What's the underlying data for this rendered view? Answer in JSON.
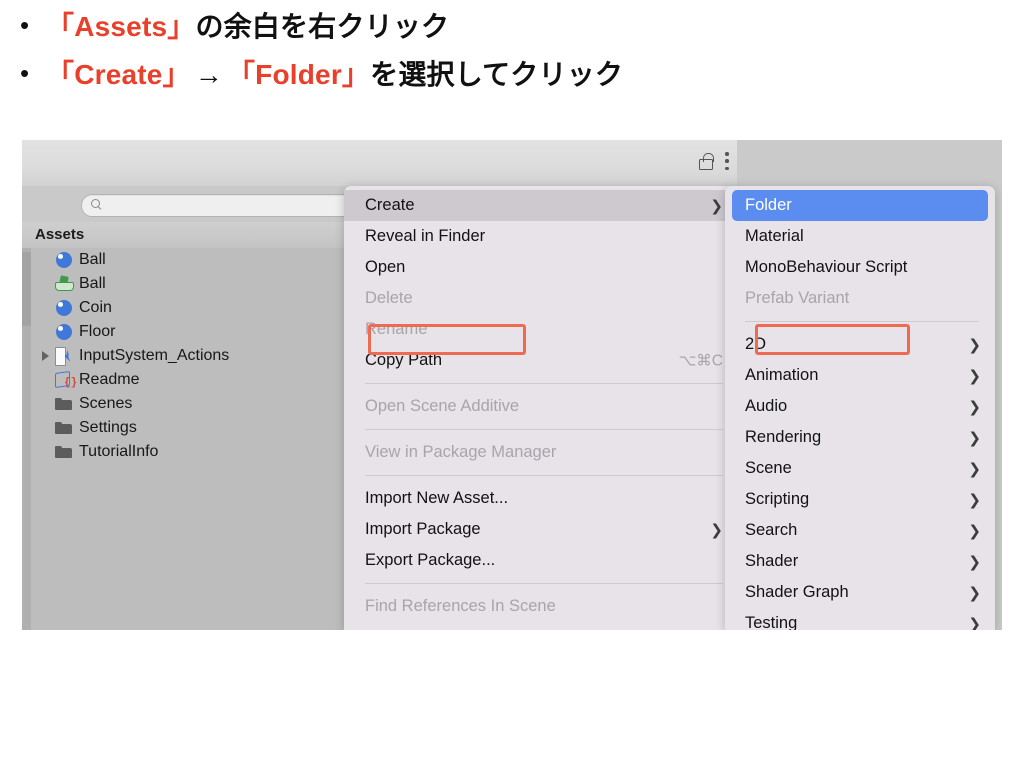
{
  "slide": {
    "bullets": [
      {
        "marker": "•",
        "segments": [
          {
            "text": "「Assets」",
            "style": "hl"
          },
          {
            "text": "の余白を右クリック",
            "style": "nm"
          }
        ]
      },
      {
        "marker": "•",
        "segments": [
          {
            "text": "「Create」",
            "style": "hl"
          },
          {
            "text": " → ",
            "style": "arrow"
          },
          {
            "text": "「Folder」",
            "style": "hl"
          },
          {
            "text": "を選択してクリック",
            "style": "nm"
          }
        ]
      }
    ],
    "bullet1_marker": "•",
    "bullet1_a": "「Assets」",
    "bullet1_b": "の余白を右クリック",
    "bullet2_marker": "•",
    "bullet2_a": "「Create」",
    "bullet2_arrow": "→",
    "bullet2_b": "「Folder」",
    "bullet2_c": "を選択してクリック",
    "accent_color": "#e8402a",
    "text_color": "#111111"
  },
  "unity": {
    "toolbar": {
      "lock_icon": "lock-open-icon",
      "menu_icon": "kebab-menu-icon"
    },
    "search": {
      "placeholder": "",
      "value": "",
      "icon": "search-icon"
    },
    "project_panel": {
      "header": "Assets",
      "items": [
        {
          "label": "Ball",
          "icon": "prefab-icon",
          "expandable": false,
          "indent": 1
        },
        {
          "label": "Ball",
          "icon": "physic-material-icon",
          "expandable": false,
          "indent": 1
        },
        {
          "label": "Coin",
          "icon": "prefab-icon",
          "expandable": false,
          "indent": 1
        },
        {
          "label": "Floor",
          "icon": "prefab-icon",
          "expandable": false,
          "indent": 1
        },
        {
          "label": "InputSystem_Actions",
          "icon": "input-actions-icon",
          "expandable": true,
          "indent": 1
        },
        {
          "label": "Readme",
          "icon": "script-asset-icon",
          "expandable": false,
          "indent": 1
        },
        {
          "label": "Scenes",
          "icon": "folder-icon",
          "expandable": false,
          "indent": 1
        },
        {
          "label": "Settings",
          "icon": "folder-icon",
          "expandable": false,
          "indent": 1
        },
        {
          "label": "TutorialInfo",
          "icon": "folder-icon",
          "expandable": false,
          "indent": 1
        }
      ]
    }
  },
  "context_menu": {
    "highlight_color": "#ef6a53",
    "items": [
      {
        "label": "Create",
        "disabled": false,
        "submenu": true,
        "highlighted": true,
        "shortcut": ""
      },
      {
        "label": "Reveal in Finder",
        "disabled": false,
        "submenu": false,
        "shortcut": ""
      },
      {
        "label": "Open",
        "disabled": false,
        "submenu": false,
        "shortcut": ""
      },
      {
        "label": "Delete",
        "disabled": true,
        "submenu": false,
        "shortcut": ""
      },
      {
        "label": "Rename",
        "disabled": true,
        "submenu": false,
        "shortcut": ""
      },
      {
        "label": "Copy Path",
        "disabled": false,
        "submenu": false,
        "shortcut": "⌥⌘C"
      },
      {
        "label": "Open Scene Additive",
        "disabled": true,
        "submenu": false,
        "shortcut": ""
      },
      {
        "label": "View in Package Manager",
        "disabled": true,
        "submenu": false,
        "shortcut": ""
      },
      {
        "label": "Import New Asset...",
        "disabled": false,
        "submenu": false,
        "shortcut": ""
      },
      {
        "label": "Import Package",
        "disabled": false,
        "submenu": true,
        "shortcut": ""
      },
      {
        "label": "Export Package...",
        "disabled": false,
        "submenu": false,
        "shortcut": ""
      },
      {
        "label": "Find References In Scene",
        "disabled": true,
        "submenu": false,
        "shortcut": ""
      }
    ]
  },
  "create_submenu": {
    "selected_bg": "#5b8cf0",
    "items": [
      {
        "label": "Folder",
        "disabled": false,
        "submenu": false,
        "selected": true
      },
      {
        "label": "Material",
        "disabled": false,
        "submenu": false,
        "selected": false
      },
      {
        "label": "MonoBehaviour Script",
        "disabled": false,
        "submenu": false,
        "selected": false
      },
      {
        "label": "Prefab Variant",
        "disabled": true,
        "submenu": false,
        "selected": false
      },
      {
        "label": "2D",
        "disabled": false,
        "submenu": true,
        "selected": false
      },
      {
        "label": "Animation",
        "disabled": false,
        "submenu": true,
        "selected": false
      },
      {
        "label": "Audio",
        "disabled": false,
        "submenu": true,
        "selected": false
      },
      {
        "label": "Rendering",
        "disabled": false,
        "submenu": true,
        "selected": false
      },
      {
        "label": "Scene",
        "disabled": false,
        "submenu": true,
        "selected": false
      },
      {
        "label": "Scripting",
        "disabled": false,
        "submenu": true,
        "selected": false
      },
      {
        "label": "Search",
        "disabled": false,
        "submenu": true,
        "selected": false
      },
      {
        "label": "Shader",
        "disabled": false,
        "submenu": true,
        "selected": false
      },
      {
        "label": "Shader Graph",
        "disabled": false,
        "submenu": true,
        "selected": false
      },
      {
        "label": "Testing",
        "disabled": false,
        "submenu": true,
        "selected": false
      }
    ],
    "caret_glyph": "❯"
  }
}
